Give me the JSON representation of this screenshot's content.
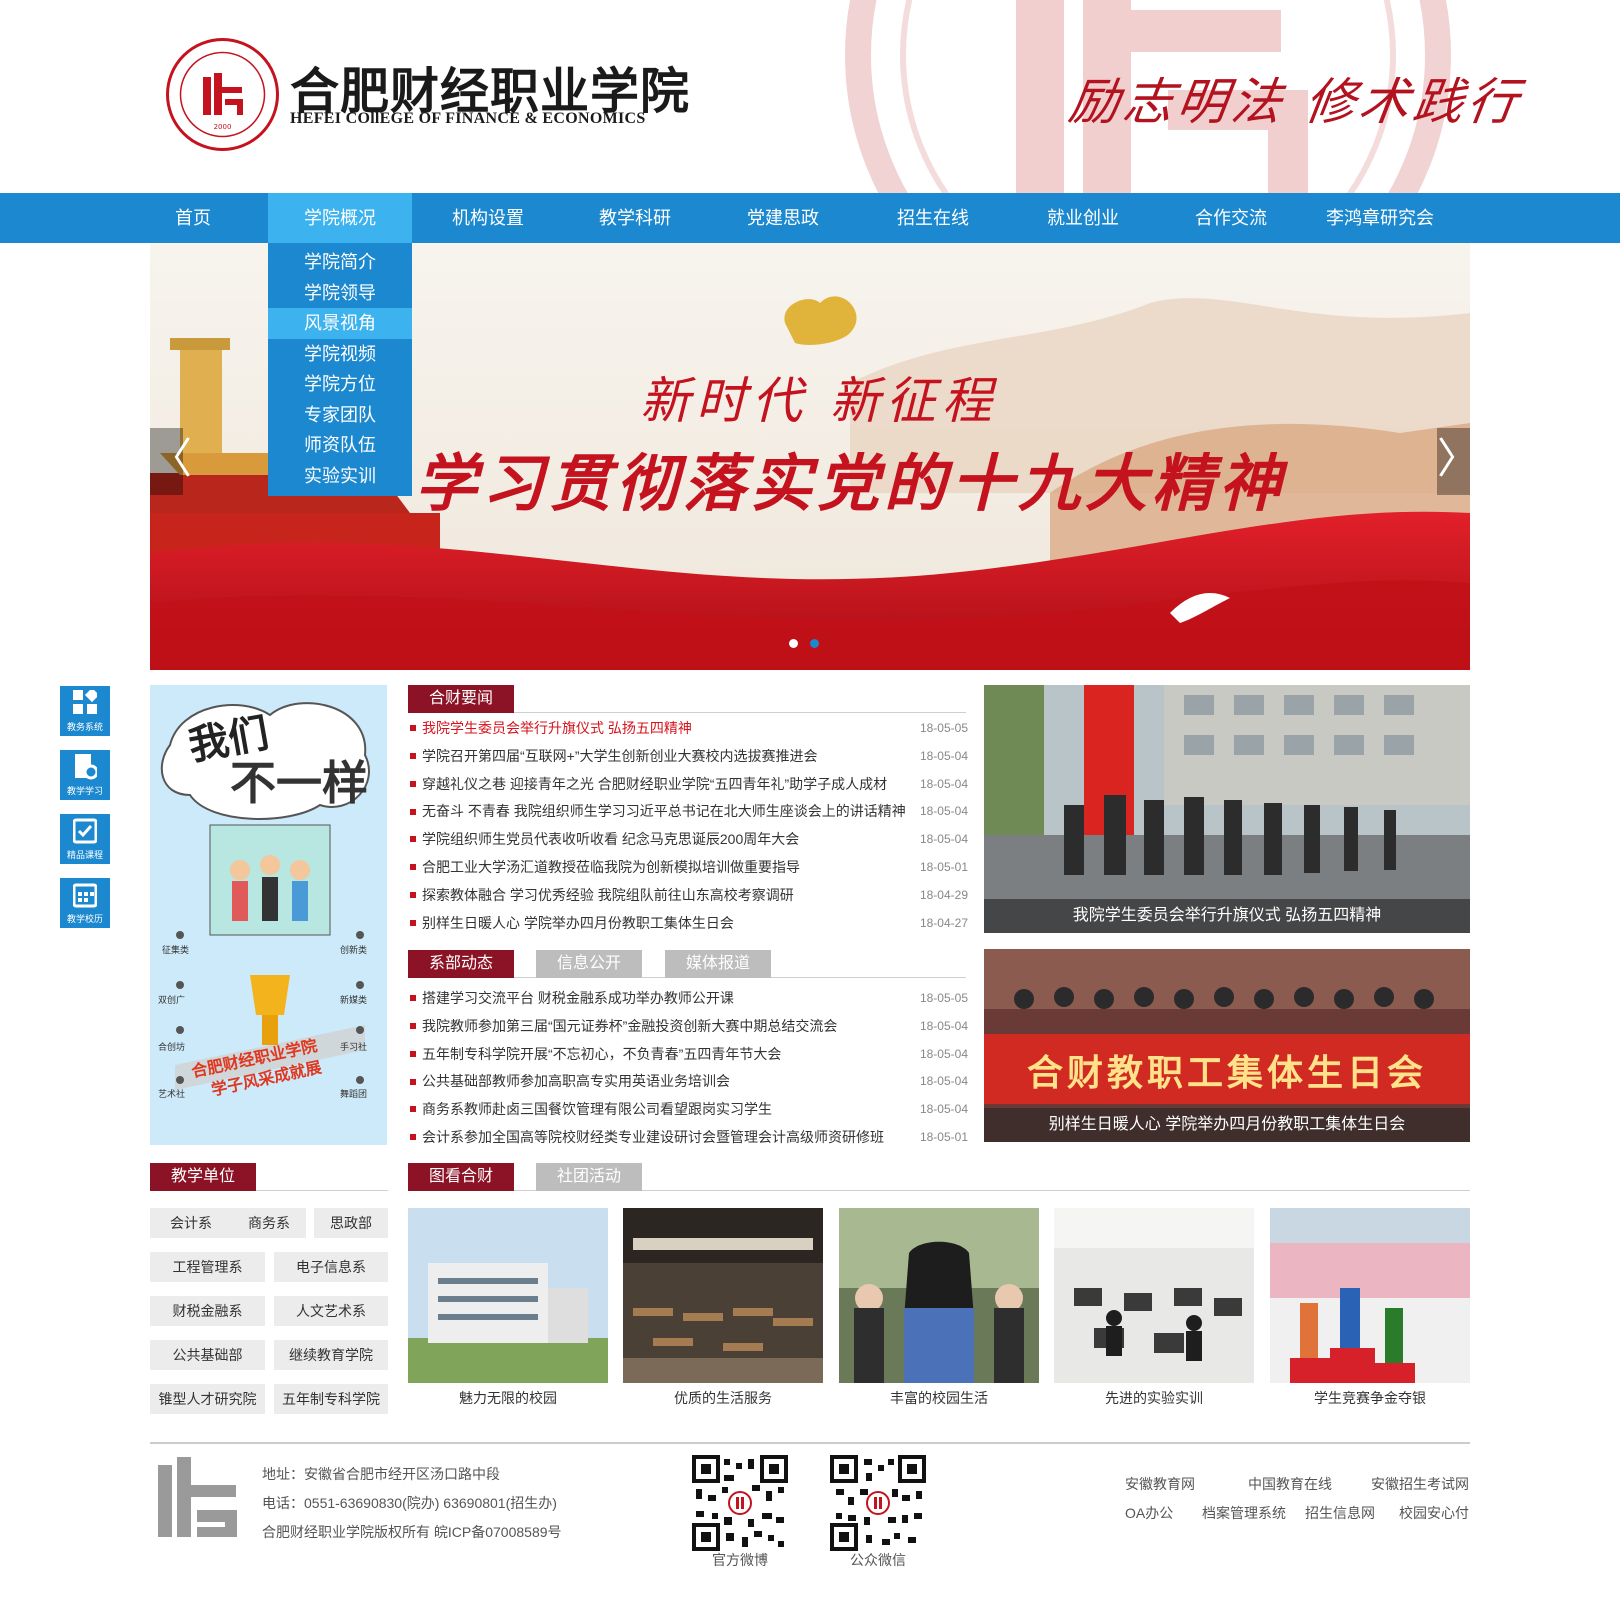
{
  "header": {
    "logo_cn": "合肥财经职业学院",
    "logo_en": "HEFEI COllEGE OF FINANCE & ECONOMICS",
    "logo_year": "2000",
    "motto": "励志明法 修术践行"
  },
  "nav": {
    "items": [
      "首页",
      "学院概况",
      "机构设置",
      "教学科研",
      "党建思政",
      "招生在线",
      "就业创业",
      "合作交流",
      "李鸿章研究会"
    ],
    "active_index": 1,
    "dropdown": [
      "学院简介",
      "学院领导",
      "风景视角",
      "学院视频",
      "学院方位",
      "专家团队",
      "师资队伍",
      "实验实训"
    ],
    "dropdown_highlight": 2
  },
  "banner": {
    "line1": "新时代 新征程",
    "line2": "学习贯彻落实党的十九大精神",
    "prev": "〈",
    "next": "〉"
  },
  "side_links": [
    "教务系统",
    "教学学习",
    "精品课程",
    "教学校历"
  ],
  "poster": {
    "title1": "我们",
    "title2": "不一样",
    "caption1": "合肥财经职业学院",
    "caption2": "学子风采成就展",
    "labels": [
      "征集类",
      "创新类",
      "双创广",
      "新媒类",
      "合创坊",
      "手习社",
      "艺术社",
      "舞蹈团"
    ]
  },
  "news1": {
    "tabs": [
      "合财要闻"
    ],
    "items": [
      {
        "title": "我院学生委员会举行升旗仪式   弘扬五四精神",
        "date": "18-05-05",
        "highlight": true
      },
      {
        "title": "学院召开第四届“互联网+”大学生创新创业大赛校内选拔赛推进会",
        "date": "18-05-04"
      },
      {
        "title": "穿越礼仪之巷 迎接青年之光 合肥财经职业学院“五四青年礼”助学子成人成材",
        "date": "18-05-04"
      },
      {
        "title": "无奋斗 不青春 我院组织师生学习习近平总书记在北大师生座谈会上的讲话精神",
        "date": "18-05-04"
      },
      {
        "title": "学院组织师生党员代表收听收看 纪念马克思诞辰200周年大会",
        "date": "18-05-04"
      },
      {
        "title": "合肥工业大学汤汇道教授莅临我院为创新模拟培训做重要指导",
        "date": "18-05-01"
      },
      {
        "title": "探索教体融合 学习优秀经验 我院组队前往山东高校考察调研",
        "date": "18-04-29"
      },
      {
        "title": "别样生日暖人心 学院举办四月份教职工集体生日会",
        "date": "18-04-27"
      }
    ]
  },
  "news2": {
    "tabs": [
      "系部动态",
      "信息公开",
      "媒体报道"
    ],
    "items": [
      {
        "title": "搭建学习交流平台   财税金融系成功举办教师公开课",
        "date": "18-05-05"
      },
      {
        "title": "我院教师参加第三届“国元证券杯”金融投资创新大赛中期总结交流会",
        "date": "18-05-04"
      },
      {
        "title": "五年制专科学院开展“不忘初心，不负青春”五四青年节大会",
        "date": "18-05-04"
      },
      {
        "title": "公共基础部教师参加高职高专实用英语业务培训会",
        "date": "18-05-04"
      },
      {
        "title": "商务系教师赴卤三国餐饮管理有限公司看望跟岗实习学生",
        "date": "18-05-04"
      },
      {
        "title": "会计系参加全国高等院校财经类专业建设研讨会暨管理会计高级师资研修班",
        "date": "18-05-01"
      }
    ]
  },
  "photos": {
    "top_caption": "我院学生委员会举行升旗仪式   弘扬五四精神",
    "bottom_banner": "合财教职工集体生日会",
    "bottom_caption": "别样生日暖人心 学院举办四月份教职工集体生日会"
  },
  "units": {
    "title": "教学单位",
    "row1": [
      "会计系",
      "商务系",
      "思政部"
    ],
    "rows": [
      [
        "工程管理系",
        "电子信息系"
      ],
      [
        "财税金融系",
        "人文艺术系"
      ],
      [
        "公共基础部",
        "继续教育学院"
      ],
      [
        "锥型人才研究院",
        "五年制专科学院"
      ]
    ]
  },
  "gallery": {
    "tabs": [
      "图看合财",
      "社团活动"
    ],
    "items": [
      "魅力无限的校园",
      "优质的生活服务",
      "丰富的校园生活",
      "先进的实验实训",
      "学生竞赛争金夺银"
    ]
  },
  "footer": {
    "address": "地址：安徽省合肥市经开区汤口路中段",
    "phone": "电话：0551-63690830(院办)    63690801(招生办)",
    "copyright": "合肥财经职业学院版权所有 皖ICP备07008589号",
    "qr1": "官方微博",
    "qr2": "公众微信",
    "links_row1": [
      "安徽教育网",
      "中国教育在线",
      "安徽招生考试网"
    ],
    "links_row2": [
      "OA办公",
      "档案管理系统",
      "招生信息网",
      "校园安心付"
    ]
  },
  "colors": {
    "nav": "#1b88cf",
    "nav_active": "#3cb2ee",
    "tab_active": "#8c1325",
    "accent_red": "#c4121e"
  }
}
